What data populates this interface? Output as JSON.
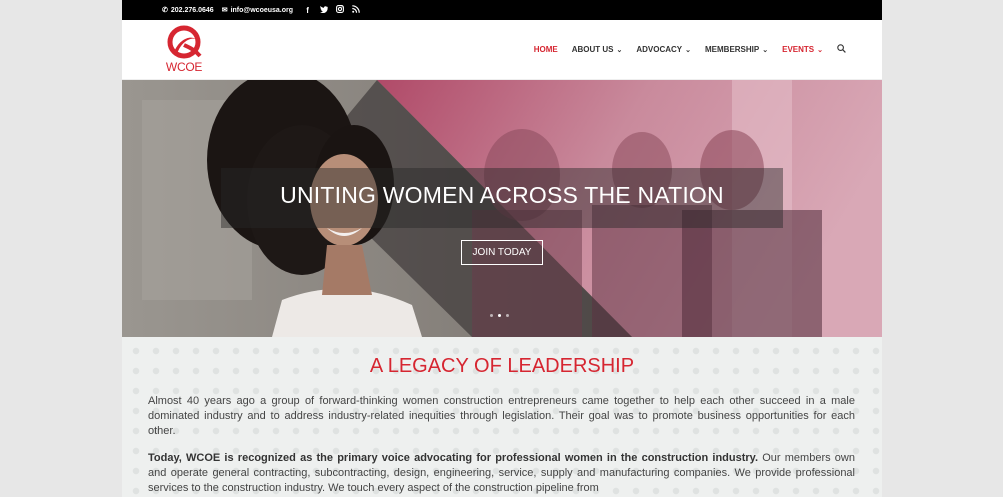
{
  "topbar": {
    "phone": "202.276.0646",
    "email": "info@wcoeusa.org",
    "social_icons": [
      "facebook-icon",
      "twitter-icon",
      "instagram-icon",
      "rss-icon"
    ]
  },
  "logo": {
    "text": "WCOE"
  },
  "nav": {
    "items": [
      {
        "label": "HOME",
        "has_dropdown": false,
        "active": true
      },
      {
        "label": "ABOUT US",
        "has_dropdown": true
      },
      {
        "label": "ADVOCACY",
        "has_dropdown": true
      },
      {
        "label": "MEMBERSHIP",
        "has_dropdown": true
      },
      {
        "label": "EVENTS",
        "has_dropdown": true
      }
    ],
    "chevron": "⌄"
  },
  "hero": {
    "title": "UNITING WOMEN ACROSS THE NATION",
    "button": "JOIN TODAY",
    "slide_count": 3,
    "active_slide": 2
  },
  "section": {
    "title": "A LEGACY OF LEADERSHIP",
    "p1": "Almost 40 years ago a group of forward-thinking women construction entrepreneurs came together to help each other succeed in a male dominated industry and to address industry-related inequities through legislation. Their goal was to promote business opportunities for each other.",
    "p2_bold": "Today, WCOE is recognized as the primary voice advocating for professional women in the construction industry.",
    "p2_rest": " Our members own and operate general contracting, subcontracting, design, engineering, service, supply and manufacturing companies. We provide professional services to the construction industry. We touch every aspect of the construction pipeline from"
  },
  "colors": {
    "accent": "#d62631",
    "topbar": "#000000"
  }
}
